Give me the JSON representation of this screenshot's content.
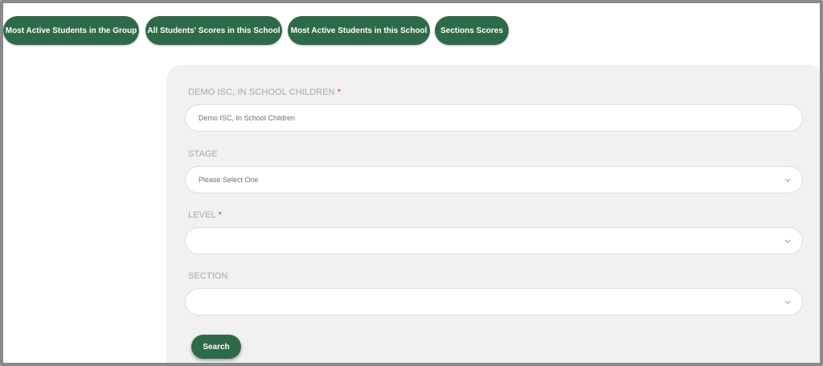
{
  "tabs": [
    {
      "label": "Most Active Students in the Group"
    },
    {
      "label": "All Students' Scores in this School"
    },
    {
      "label": "Most Active Students in this School"
    },
    {
      "label": "Sections Scores"
    }
  ],
  "form": {
    "school": {
      "label": "DEMO ISC, IN SCHOOL CHILDREN",
      "required_mark": "*",
      "value": "Demo ISC, In School Children"
    },
    "stage": {
      "label": "STAGE",
      "value": "Please Select One"
    },
    "level": {
      "label": "LEVEL",
      "required_mark": "*",
      "value": ""
    },
    "section": {
      "label": "SECTION",
      "value": ""
    }
  },
  "search": {
    "label": "Search"
  },
  "colors": {
    "accent": "#2f6a48",
    "required": "#e03c31",
    "panel": "#f1f1f1"
  }
}
